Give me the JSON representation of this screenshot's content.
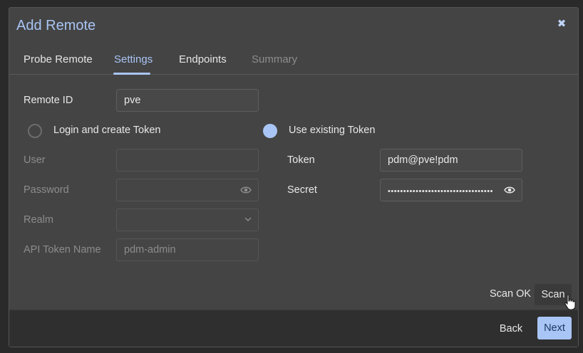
{
  "dialog": {
    "title": "Add Remote",
    "close_icon": "close-icon"
  },
  "tabs": [
    {
      "label": "Probe Remote",
      "state": "normal"
    },
    {
      "label": "Settings",
      "state": "active"
    },
    {
      "label": "Endpoints",
      "state": "normal"
    },
    {
      "label": "Summary",
      "state": "disabled"
    }
  ],
  "form": {
    "remote_id": {
      "label": "Remote ID",
      "value": "pve"
    },
    "auth_mode": {
      "options": [
        {
          "label": "Login and create Token",
          "checked": false
        },
        {
          "label": "Use existing Token",
          "checked": true
        }
      ]
    },
    "user": {
      "label": "User",
      "value": ""
    },
    "password": {
      "label": "Password",
      "value": "",
      "icon": "eye-icon"
    },
    "realm": {
      "label": "Realm",
      "value": "",
      "icon": "chevron-down-icon"
    },
    "api_token_name": {
      "label": "API Token Name",
      "placeholder": "pdm-admin"
    },
    "token": {
      "label": "Token",
      "value": "pdm@pve!pdm"
    },
    "secret": {
      "label": "Secret",
      "value": "••••••••••••••••••••••••••••••••••",
      "icon": "eye-icon"
    }
  },
  "scan": {
    "status": "Scan OK",
    "button_label": "Scan"
  },
  "footer": {
    "back_label": "Back",
    "next_label": "Next"
  },
  "colors": {
    "accent": "#a9c5f5",
    "background": "#444444",
    "footer": "#2f2f2f"
  }
}
